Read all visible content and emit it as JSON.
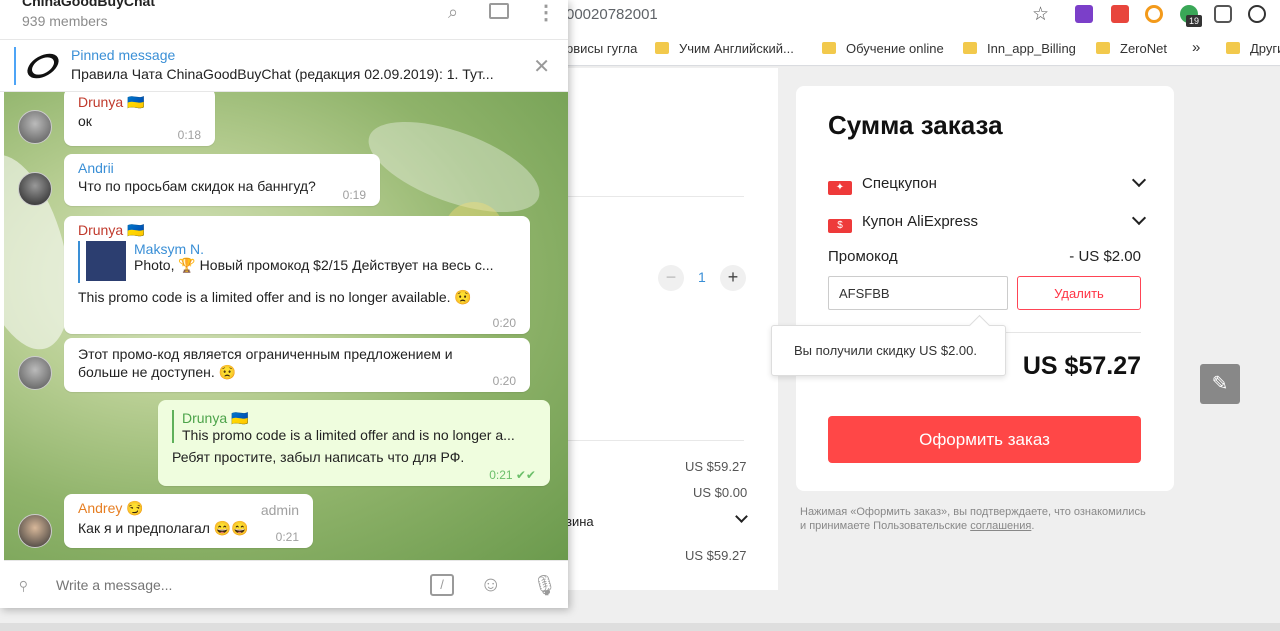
{
  "browser": {
    "url_fragment": "00020782001",
    "bookmarks": [
      "рвисы гугла",
      "Учим Английский...",
      "Обучение online",
      "Inn_app_Billing",
      "ZeroNet",
      "»",
      "Други"
    ],
    "ext_badge": "19"
  },
  "order": {
    "title": "Сумма заказа",
    "special_coupon": "Спецкупон",
    "ali_coupon": "Купон AliExpress",
    "promo_label": "Промокод",
    "promo_discount": "- US $2.00",
    "promo_code": "AFSFBB",
    "delete_label": "Удалить",
    "tooltip": "Вы получили скидку US $2.00.",
    "total": "US $57.27",
    "checkout_label": "Оформить заказ",
    "disclaimer_1": "Нажимая «Оформить заказ», вы подтверждаете, что ознакомились",
    "disclaimer_2": "и принимаете Пользовательские ",
    "disclaimer_link": "соглашения",
    "disclaimer_end": ".",
    "left_prices": [
      "US $59.27",
      "US $0.00",
      "US $59.27"
    ],
    "left_label": "зина",
    "qty": "1"
  },
  "telegram": {
    "chat_title": "ChinaGoodBuyChat",
    "members": "939 members",
    "pinned_title": "Pinned message",
    "pinned_text": "Правила Чата ChinaGoodBuyChat (редакция 02.09.2019): 1. Тут...",
    "composer_placeholder": "Write a message...",
    "messages": [
      {
        "author": "Drunya 🇺🇦",
        "text": "ок",
        "time": "0:18"
      },
      {
        "author": "Andrii",
        "text": "Что по просьбам скидок на баннгуд?",
        "time": "0:19"
      },
      {
        "author": "Drunya 🇺🇦",
        "quote_author": "Maksym N.",
        "quote_text": "Photo, 🏆 Новый промокод $2/15 Действует на весь с...",
        "text": "This promo code is a limited offer and is no longer available. 😟",
        "time": "0:20"
      },
      {
        "text_1": "Этот промо-код является ограниченным предложением и",
        "text_2": "больше не доступен. 😟",
        "time": "0:20"
      },
      {
        "quote_author": "Drunya 🇺🇦",
        "quote_text": "This promo code is a limited offer and is no longer a...",
        "text": "Ребят простите, забыл написать что для РФ.",
        "time": "0:21 ✔✔"
      },
      {
        "author": "Andrey 😏",
        "role": "admin",
        "text": "Как я и предполагал 😄😄",
        "time": "0:21"
      }
    ]
  },
  "colors": {
    "accent_red": "#ff4747",
    "tg_link_blue": "#3a8fd6",
    "out_bubble": "#effdde"
  }
}
